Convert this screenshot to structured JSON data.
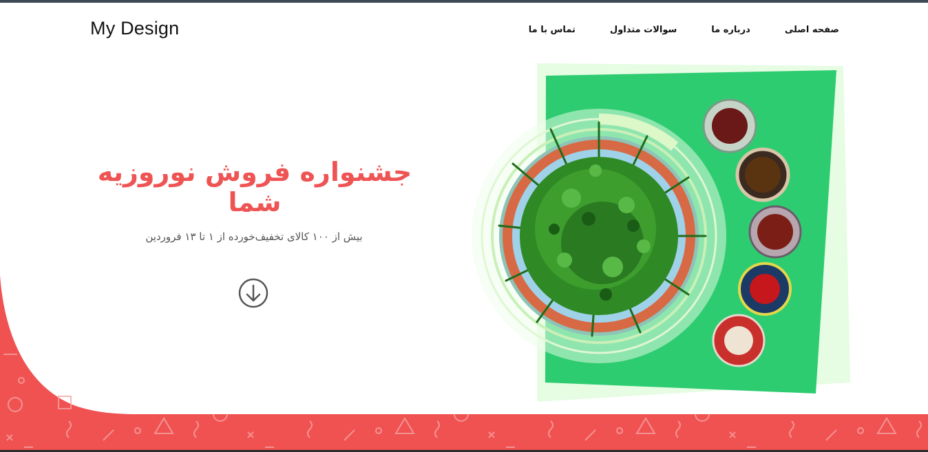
{
  "brand": {
    "logo_text": "My Design"
  },
  "nav": {
    "items": [
      {
        "label": "صفحه اصلی"
      },
      {
        "label": "درباره ما"
      },
      {
        "label": "سوالات متداول"
      },
      {
        "label": "تماس با ما"
      }
    ]
  },
  "hero": {
    "title": "جشنواره فروش نوروزیه شما",
    "subtitle": "بیش از ۱۰۰ کالای تخفیف‌خورده از ۱ تا ۱۳ فروردین",
    "scroll_icon": "arrow-down-circle-icon",
    "image_subject": "haft-sin-sabzeh-and-bowls"
  },
  "colors": {
    "accent": "#ef5454",
    "green_panel": "#2ecc71",
    "light_green": "#e3fbe0",
    "band": "#f05252"
  }
}
